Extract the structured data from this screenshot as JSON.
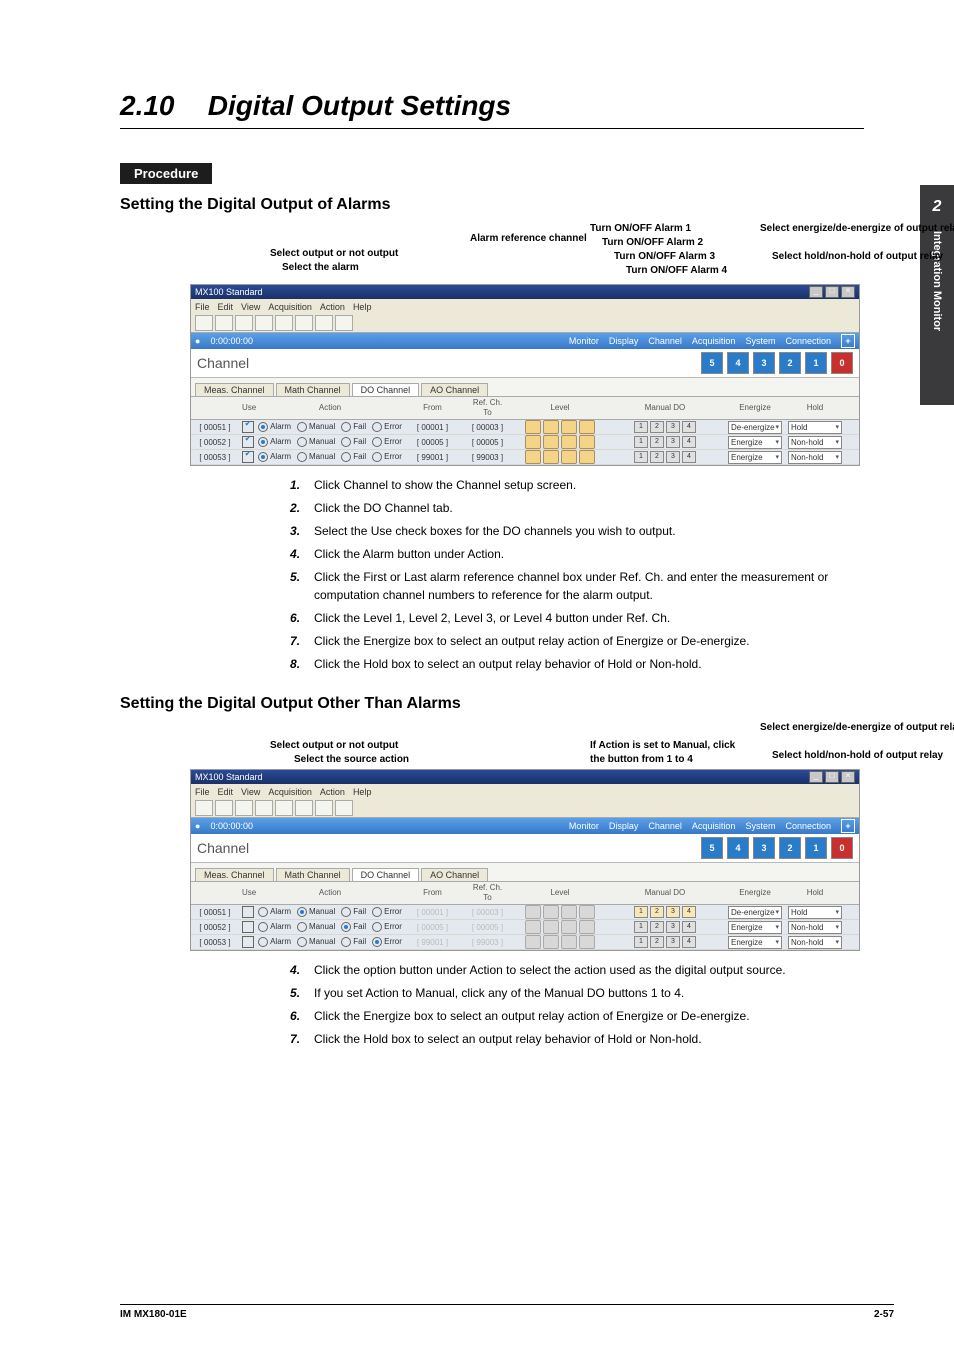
{
  "sideTab": {
    "chapter": "2",
    "label": "Integration Monitor"
  },
  "title": {
    "number": "2.10",
    "text": "Digital Output Settings"
  },
  "procedure": "Procedure",
  "section1": {
    "heading": "Setting the Digital Output of Alarms",
    "labels": {
      "selOutput": "Select output or not output",
      "selAlarm": "Select the alarm",
      "alarmRef": "Alarm reference channel",
      "t1": "Turn ON/OFF Alarm 1",
      "t2": "Turn ON/OFF Alarm 2",
      "t3": "Turn ON/OFF Alarm 3",
      "t4": "Turn ON/OFF Alarm 4",
      "selEnergize": "Select energize/de-energize of output relay",
      "selHold": "Select hold/non-hold of output relay"
    },
    "steps": [
      "Click Channel to show the Channel setup screen.",
      "Click the DO Channel tab.",
      "Select the Use check boxes for the DO channels you wish to output.",
      "Click the Alarm button under Action.",
      "Click the First or Last alarm reference channel box under Ref. Ch. and enter the measurement or computation channel numbers to reference for the alarm output.",
      "Click the Level 1, Level 2, Level 3, or Level 4 button under Ref. Ch.",
      "Click the Energize box to select an output relay action of Energize or De-energize.",
      "Click the Hold box to select an output relay behavior of Hold or Non-hold."
    ]
  },
  "section2": {
    "heading": "Setting the Digital Output Other Than Alarms",
    "labels": {
      "selOutput": "Select output or not output",
      "selSource": "Select the source action",
      "manual": "If Action is set to Manual, click the button from 1 to 4",
      "selEnergize": "Select energize/de-energize of output relay",
      "selHold": "Select hold/non-hold of output relay"
    },
    "steps": [
      "Click the option button under Action to select the action used as the digital output source.",
      "If you set Action to Manual, click any of the Manual DO buttons 1 to 4.",
      "Click the Energize box to select an output relay action of Energize or De-energize.",
      "Click the Hold box to select an output relay behavior of Hold or Non-hold."
    ]
  },
  "win": {
    "title": "MX100 Standard",
    "menu": [
      "File",
      "Edit",
      "View",
      "Acquisition",
      "Action",
      "Help"
    ],
    "timer": "0:00:00:00",
    "statusItems": [
      "Monitor",
      "Display",
      "Channel",
      "Acquisition",
      "System",
      "Connection"
    ],
    "channelTitle": "Channel",
    "tabs": [
      "Meas. Channel",
      "Math Channel",
      "DO Channel",
      "AO Channel"
    ],
    "activeTab": "DO Channel",
    "cols": {
      "use": "Use",
      "action": "Action",
      "refFrom": "From",
      "refTo": "To",
      "refCh": "Ref. Ch.",
      "level": "Level",
      "manualDO": "Manual DO",
      "energize": "Energize",
      "hold": "Hold"
    },
    "actOpts": {
      "alarm": "Alarm",
      "manual": "Manual",
      "fail": "Fail",
      "error": "Error"
    },
    "energizeOpts": {
      "de": "De-energize",
      "en": "Energize"
    },
    "holdOpts": {
      "hold": "Hold",
      "non": "Non-hold"
    },
    "rows1": [
      {
        "ch": "[ 00051 ]",
        "use": true,
        "act": "alarm",
        "from": "[ 00001 ]",
        "to": "[ 00003 ]",
        "energize": "De-energize",
        "hold": "Hold"
      },
      {
        "ch": "[ 00052 ]",
        "use": true,
        "act": "alarm",
        "from": "[ 00005 ]",
        "to": "[ 00005 ]",
        "energize": "Energize",
        "hold": "Non-hold"
      },
      {
        "ch": "[ 00053 ]",
        "use": true,
        "act": "alarm",
        "from": "[ 99001 ]",
        "to": "[ 99003 ]",
        "energize": "Energize",
        "hold": "Non-hold"
      }
    ],
    "rows2": [
      {
        "ch": "[ 00051 ]",
        "use": false,
        "act": "manual",
        "from": "[ 00001 ]",
        "to": "[ 00003 ]",
        "energize": "De-energize",
        "hold": "Hold"
      },
      {
        "ch": "[ 00052 ]",
        "use": false,
        "act": "fail",
        "from": "[ 00005 ]",
        "to": "[ 00005 ]",
        "energize": "Energize",
        "hold": "Non-hold"
      },
      {
        "ch": "[ 00053 ]",
        "use": false,
        "act": "error",
        "from": "[ 99001 ]",
        "to": "[ 99003 ]",
        "energize": "Energize",
        "hold": "Non-hold"
      }
    ]
  },
  "footer": {
    "left": "IM MX180-01E",
    "right": "2-57"
  }
}
